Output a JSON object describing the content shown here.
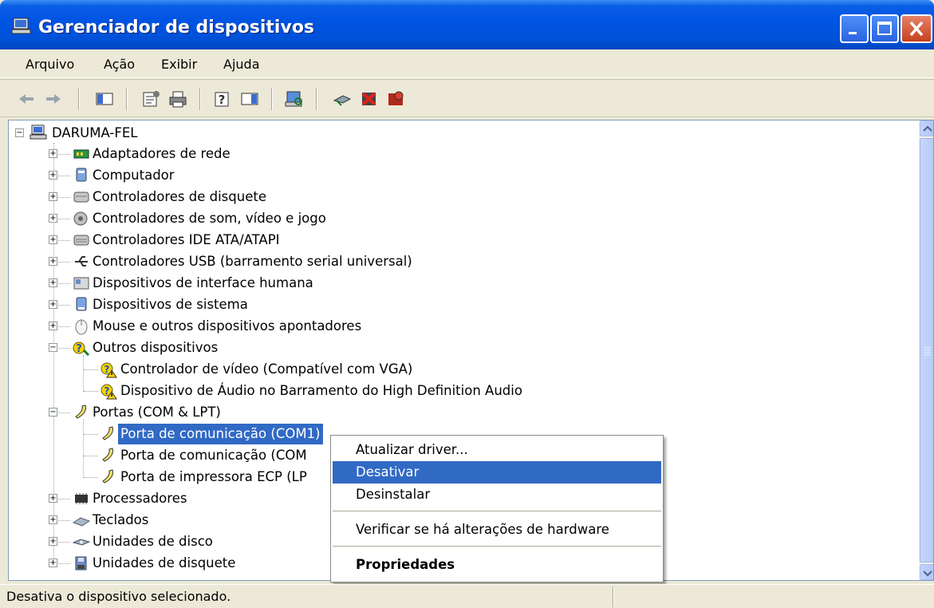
{
  "window": {
    "title": "Gerenciador de dispositivos",
    "icon": "computer-icon",
    "controls": [
      "minimize",
      "maximize",
      "close"
    ]
  },
  "menubar": {
    "items": [
      "Arquivo",
      "Ação",
      "Exibir",
      "Ajuda"
    ]
  },
  "toolbar": {
    "buttons": [
      "back-arrow-icon",
      "forward-arrow-icon",
      "show-hide-tree-icon",
      "properties-icon",
      "print-icon",
      "help-icon",
      "show-hide-action-pane-icon",
      "scan-hardware-icon",
      "update-driver-icon",
      "uninstall-icon",
      "disable-icon"
    ]
  },
  "tree": {
    "root": "DARUMA-FEL",
    "categories": [
      {
        "label": "Adaptadores de rede",
        "icon": "network-adapter-icon"
      },
      {
        "label": "Computador",
        "icon": "computer-icon"
      },
      {
        "label": "Controladores de disquete",
        "icon": "floppy-controller-icon"
      },
      {
        "label": "Controladores de som, vídeo e jogo",
        "icon": "sound-icon"
      },
      {
        "label": "Controladores IDE ATA/ATAPI",
        "icon": "ide-controller-icon"
      },
      {
        "label": "Controladores USB (barramento serial universal)",
        "icon": "usb-icon"
      },
      {
        "label": "Dispositivos de interface humana",
        "icon": "hid-icon"
      },
      {
        "label": "Dispositivos de sistema",
        "icon": "system-device-icon"
      },
      {
        "label": "Mouse e outros dispositivos apontadores",
        "icon": "mouse-icon"
      },
      {
        "label": "Outros dispositivos",
        "icon": "unknown-device-icon"
      },
      {
        "label": "Controlador de vídeo (Compatível com VGA)",
        "icon": "warning-device-icon"
      },
      {
        "label": "Dispositivo de Áudio no Barramento do High Definition Audio",
        "icon": "warning-device-icon"
      },
      {
        "label": "Portas (COM & LPT)",
        "icon": "port-icon"
      },
      {
        "label": "Porta de comunicação (COM1)",
        "icon": "port-icon"
      },
      {
        "label": "Porta de comunicação (COM",
        "icon": "port-icon"
      },
      {
        "label": "Porta de impressora ECP (LP",
        "icon": "port-icon"
      },
      {
        "label": "Processadores",
        "icon": "processor-icon"
      },
      {
        "label": "Teclados",
        "icon": "keyboard-icon"
      },
      {
        "label": "Unidades de disco",
        "icon": "disk-drive-icon"
      },
      {
        "label": "Unidades de disquete",
        "icon": "floppy-drive-icon"
      }
    ]
  },
  "context_menu": {
    "items": [
      "Atualizar driver...",
      "Desativar",
      "Desinstalar",
      "Verificar se há alterações de hardware",
      "Propriedades"
    ],
    "highlighted": "Desativar"
  },
  "statusbar": {
    "text": "Desativa o dispositivo selecionado."
  },
  "colors": {
    "titlebar": "#0054e3",
    "selection": "#316ac5",
    "window_bg": "#ece9d8"
  }
}
